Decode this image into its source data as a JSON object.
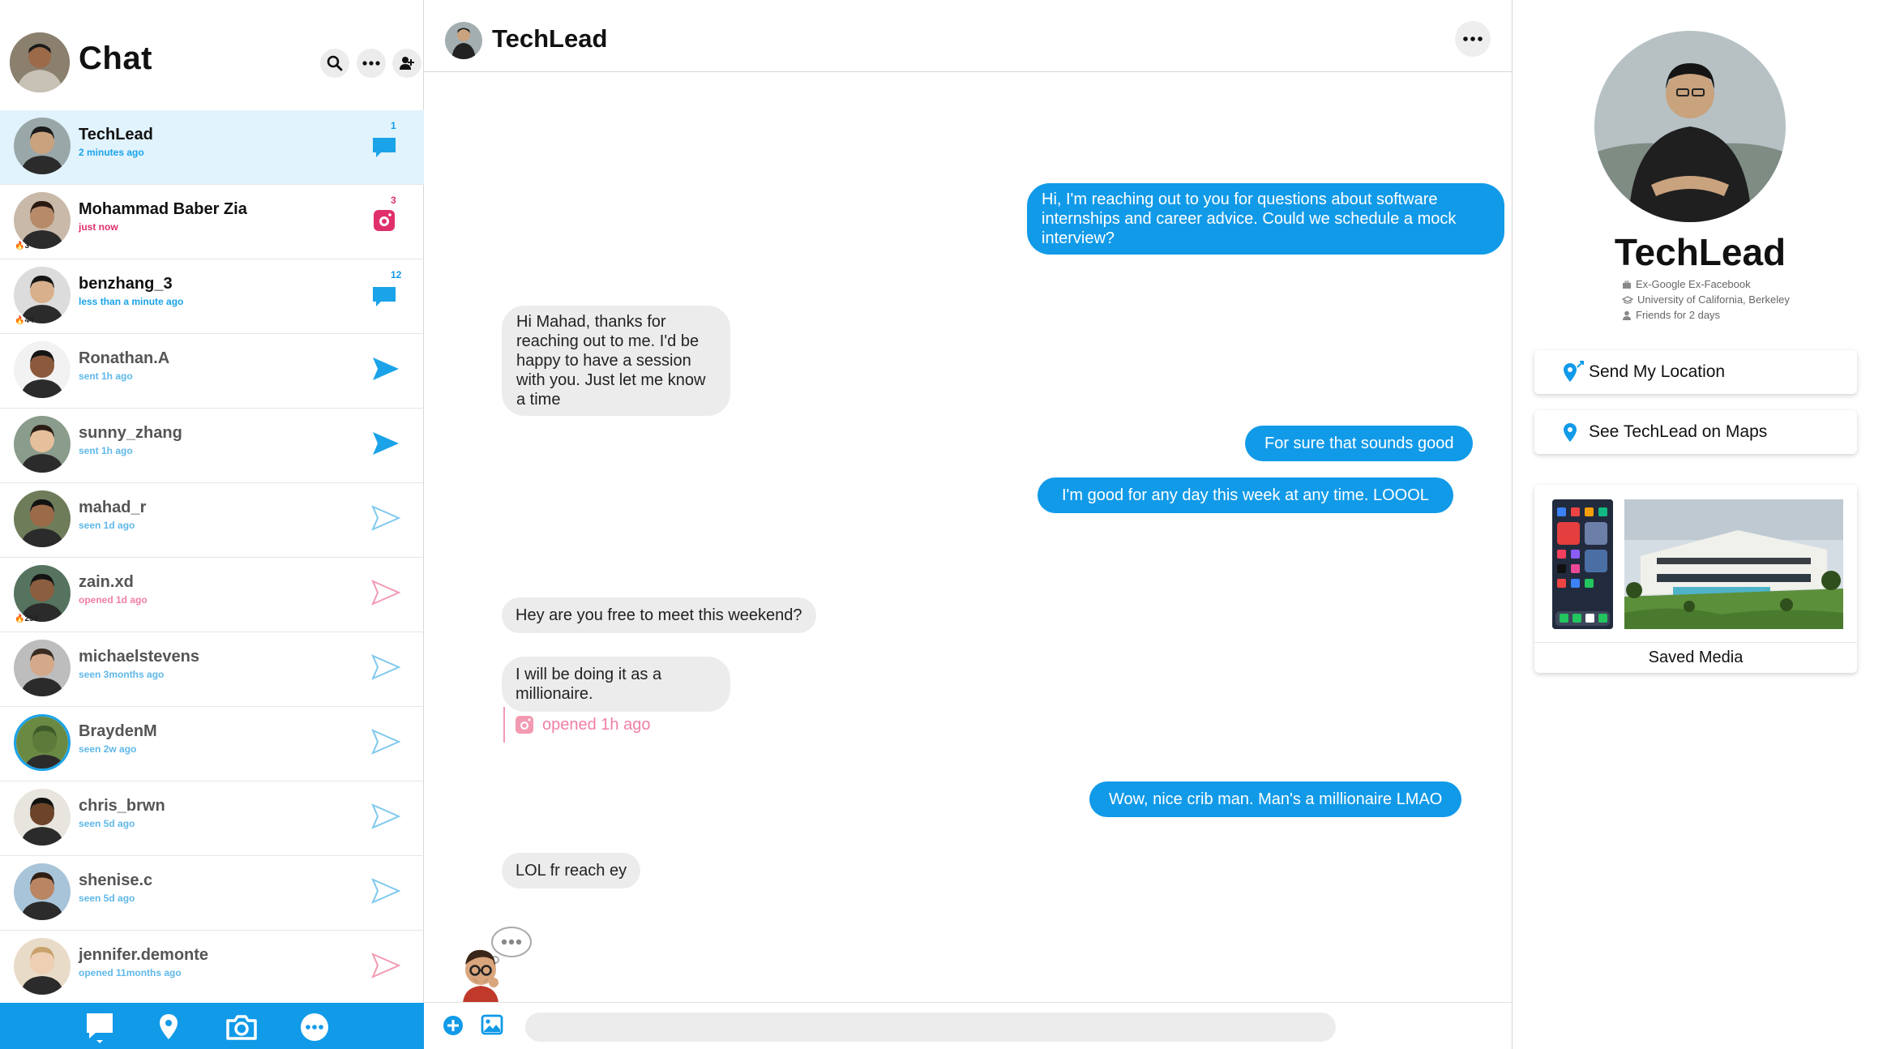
{
  "sidebar": {
    "title": "Chat",
    "chats": [
      {
        "name": "TechLead",
        "status": "2 minutes ago",
        "status_color": "#1aa3e8",
        "icon": "chat-filled-blue-icon",
        "count": "1",
        "streak": "",
        "selected": true,
        "ring": false,
        "name_dim": false,
        "skin": "#c9a27e",
        "hair": "#1b1b1b",
        "bg": "#9aa7a8"
      },
      {
        "name": "Mohammad Baber Zia",
        "status": "just now",
        "status_color": "#e0306c",
        "icon": "snap-filled-red-icon",
        "count": "3",
        "streak": "🔥3",
        "selected": false,
        "ring": false,
        "name_dim": false,
        "skin": "#b78b6a",
        "hair": "#2a1a12",
        "bg": "#c8b9a9"
      },
      {
        "name": "benzhang_3",
        "status": "less than a minute ago",
        "status_color": "#1aa3e8",
        "icon": "chat-filled-blue-icon",
        "count": "12",
        "streak": "🔥44",
        "selected": false,
        "ring": false,
        "name_dim": false,
        "skin": "#d8b08c",
        "hair": "#161616",
        "bg": "#dcdcdc"
      },
      {
        "name": "Ronathan.A",
        "status": "sent 1h ago",
        "status_color": "#5fb8e8",
        "icon": "sent-filled-icon",
        "count": "",
        "streak": "",
        "selected": false,
        "ring": false,
        "name_dim": true,
        "skin": "#8b5a3c",
        "hair": "#151515",
        "bg": "#f2f2f2"
      },
      {
        "name": "sunny_zhang",
        "status": "sent 1h ago",
        "status_color": "#5fb8e8",
        "icon": "sent-filled-icon",
        "count": "",
        "streak": "",
        "selected": false,
        "ring": false,
        "name_dim": true,
        "skin": "#e6bf9c",
        "hair": "#2a1d16",
        "bg": "#8a9c8c"
      },
      {
        "name": "mahad_r",
        "status": "seen 1d ago",
        "status_color": "#5fb8e8",
        "icon": "sent-outline-blue-icon",
        "count": "",
        "streak": "",
        "selected": false,
        "ring": false,
        "name_dim": true,
        "skin": "#9b6a48",
        "hair": "#121212",
        "bg": "#6e7c5a"
      },
      {
        "name": "zain.xd",
        "status": "opened 1d ago",
        "status_color": "#f07fa3",
        "icon": "sent-outline-pink-icon",
        "count": "",
        "streak": "🔥250",
        "selected": false,
        "ring": false,
        "name_dim": true,
        "skin": "#8c5e40",
        "hair": "#141414",
        "bg": "#55735e"
      },
      {
        "name": "michaelstevens",
        "status": "seen 3months ago",
        "status_color": "#5fb8e8",
        "icon": "sent-outline-blue-icon",
        "count": "",
        "streak": "",
        "selected": false,
        "ring": false,
        "name_dim": true,
        "skin": "#d3a98a",
        "hair": "#3a2c22",
        "bg": "#bdbdbd"
      },
      {
        "name": "BraydenM",
        "status": "seen 2w ago",
        "status_color": "#5fb8e8",
        "icon": "sent-outline-blue-icon",
        "count": "",
        "streak": "",
        "selected": false,
        "ring": true,
        "name_dim": true,
        "skin": "#5d7a3a",
        "hair": "#3e5a2a",
        "bg": "#6a8a44"
      },
      {
        "name": "chris_brwn",
        "status": "seen 5d ago",
        "status_color": "#5fb8e8",
        "icon": "sent-outline-blue-icon",
        "count": "",
        "streak": "",
        "selected": false,
        "ring": false,
        "name_dim": true,
        "skin": "#6b4429",
        "hair": "#111111",
        "bg": "#e8e4de"
      },
      {
        "name": "shenise.c",
        "status": "seen 5d ago",
        "status_color": "#5fb8e8",
        "icon": "sent-outline-blue-icon",
        "count": "",
        "streak": "",
        "selected": false,
        "ring": false,
        "name_dim": true,
        "skin": "#b98563",
        "hair": "#2e1d14",
        "bg": "#a8c4d8"
      },
      {
        "name": "jennifer.demonte",
        "status": "opened 11months ago",
        "status_color": "#5fb8e8",
        "icon": "sent-outline-pink-icon",
        "count": "",
        "streak": "",
        "selected": false,
        "ring": false,
        "name_dim": true,
        "skin": "#efcfb3",
        "hair": "#c9a16c",
        "bg": "#e8dcc8"
      }
    ]
  },
  "chat": {
    "title": "TechLead",
    "messages": [
      {
        "from": "me",
        "text": "Hi, I'm reaching out to you for questions about software internships and career advice. Could we schedule a mock interview?"
      },
      {
        "from": "them",
        "text": "Hi Mahad, thanks for reaching out to me. I'd be happy to have a session with you. Just let me know a time"
      },
      {
        "from": "me",
        "text": "For sure that sounds good"
      },
      {
        "from": "me",
        "text": "I'm good for any day this week at any time. LOOOL"
      },
      {
        "from": "them",
        "text": "Hey are you free to meet this weekend?"
      },
      {
        "from": "them",
        "text": "I will be doing it as a millionaire."
      },
      {
        "from": "me",
        "text": "Wow, nice crib man. Man's a millionaire LMAO"
      },
      {
        "from": "them",
        "text": "LOL fr reach ey"
      }
    ],
    "opened_status": "opened 1h ago",
    "input_placeholder": ""
  },
  "profile": {
    "name": "TechLead",
    "work": "Ex-Google Ex-Facebook",
    "school": "University of California, Berkeley",
    "friends": "Friends for 2 days",
    "send_location": "Send My Location",
    "see_on_maps": "See TechLead on Maps",
    "saved_media": "Saved Media"
  },
  "colors": {
    "accent": "#119ae8",
    "snap_red": "#e0306c",
    "opened_pink": "#f07fa3"
  }
}
